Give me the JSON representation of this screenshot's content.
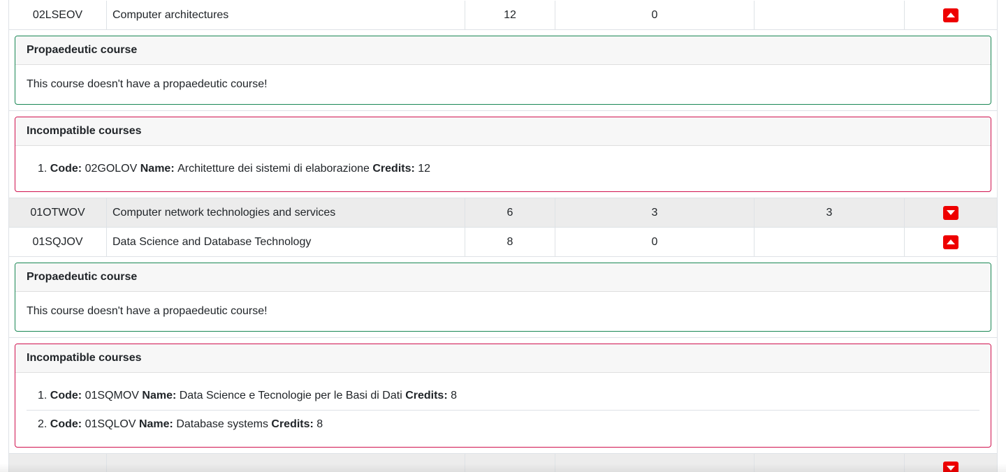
{
  "courses": [
    {
      "code": "02LSEOV",
      "name": "Computer architectures",
      "credits": "12",
      "enrolled": "0",
      "max": "",
      "expanded": true
    },
    {
      "code": "01OTWOV",
      "name": "Computer network technologies and services",
      "credits": "6",
      "enrolled": "3",
      "max": "3",
      "expanded": false
    },
    {
      "code": "01SQJOV",
      "name": "Data Science and Database Technology",
      "credits": "8",
      "enrolled": "0",
      "max": "",
      "expanded": true
    }
  ],
  "labels": {
    "propaedeutic_title": "Propaedeutic course",
    "no_propaedeutic": "This course doesn't have a propaedeutic course!",
    "incompatible_title": "Incompatible courses",
    "code": "Code:",
    "name": "Name:",
    "credits": "Credits:"
  },
  "incompatible": {
    "c1": [
      {
        "num": "1.",
        "code": "02GOLOV",
        "name": "Architetture dei sistemi di elaborazione",
        "credits": "12"
      }
    ],
    "c3": [
      {
        "num": "1.",
        "code": "01SQMOV",
        "name": "Data Science e Tecnologie per le Basi di Dati",
        "credits": "8"
      },
      {
        "num": "2.",
        "code": "01SQLOV",
        "name": "Database systems",
        "credits": "8"
      }
    ]
  },
  "icons": {
    "collapse": "caret-up-icon",
    "expand": "caret-down-icon"
  },
  "colors": {
    "toggle": "#ee0000",
    "propaedeutic_border": "#198754",
    "incompatible_border": "#d0114e",
    "alt_row": "#ececec"
  }
}
